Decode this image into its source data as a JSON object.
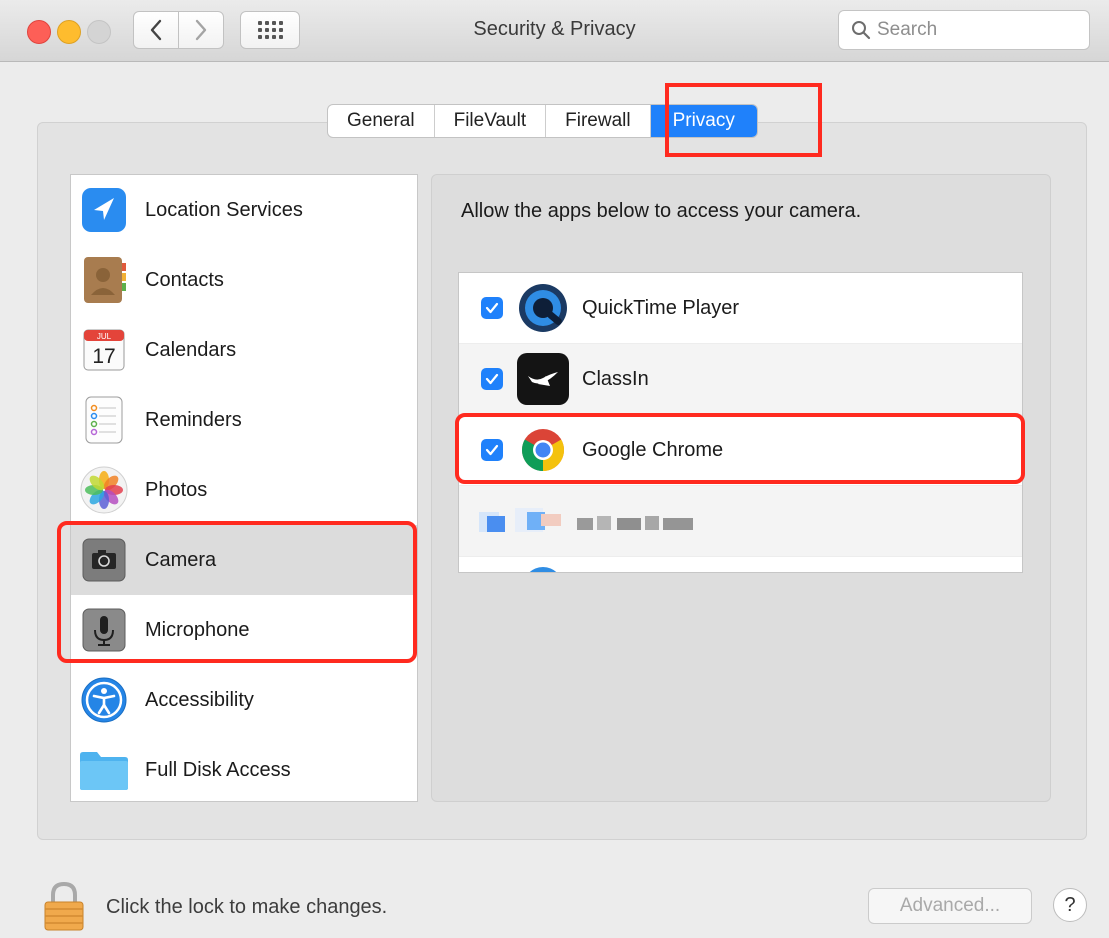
{
  "window": {
    "title": "Security & Privacy",
    "search_placeholder": "Search"
  },
  "tabs": [
    {
      "label": "General",
      "active": false
    },
    {
      "label": "FileVault",
      "active": false
    },
    {
      "label": "Firewall",
      "active": false
    },
    {
      "label": "Privacy",
      "active": true
    }
  ],
  "sidebar": {
    "items": [
      {
        "label": "Location Services",
        "icon": "location-arrow-icon",
        "selected": false
      },
      {
        "label": "Contacts",
        "icon": "contacts-book-icon",
        "selected": false
      },
      {
        "label": "Calendars",
        "icon": "calendar-icon",
        "selected": false
      },
      {
        "label": "Reminders",
        "icon": "reminders-icon",
        "selected": false
      },
      {
        "label": "Photos",
        "icon": "photos-flower-icon",
        "selected": false
      },
      {
        "label": "Camera",
        "icon": "camera-icon",
        "selected": true
      },
      {
        "label": "Microphone",
        "icon": "microphone-icon",
        "selected": false
      },
      {
        "label": "Accessibility",
        "icon": "accessibility-icon",
        "selected": false
      },
      {
        "label": "Full Disk Access",
        "icon": "folder-icon",
        "selected": false
      }
    ]
  },
  "calendar_icon": {
    "month": "JUL",
    "day": "17"
  },
  "panel": {
    "description": "Allow the apps below to access your camera.",
    "apps": [
      {
        "label": "QuickTime Player",
        "checked": true,
        "icon": "quicktime-icon"
      },
      {
        "label": "ClassIn",
        "checked": true,
        "icon": "classin-icon"
      },
      {
        "label": "Google Chrome",
        "checked": true,
        "icon": "chrome-icon"
      }
    ]
  },
  "footer": {
    "lock_text": "Click the lock to make changes.",
    "advanced_label": "Advanced...",
    "help_label": "?"
  },
  "colors": {
    "accent": "#1f81fb",
    "highlight": "#ff2a1f"
  }
}
